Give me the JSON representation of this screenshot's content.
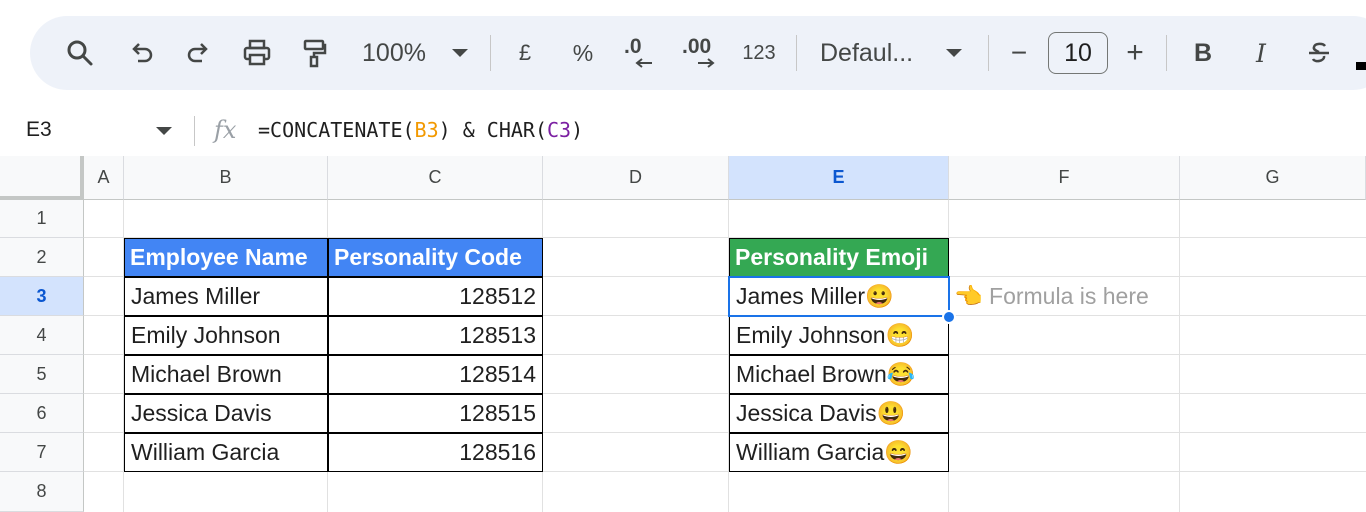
{
  "toolbar": {
    "zoom": "100%",
    "currency": "£",
    "percent": "%",
    "decrease_decimal": ".0",
    "increase_decimal": ".00",
    "more_formats": "123",
    "font_name": "Defaul...",
    "font_size": "10",
    "minus": "−",
    "plus": "+",
    "bold": "B",
    "italic": "I",
    "icons": [
      "search-icon",
      "undo-icon",
      "redo-icon",
      "print-icon",
      "paint-format-icon",
      "strikethrough-icon"
    ]
  },
  "formula_bar": {
    "cell_ref": "E3",
    "fx": "fx",
    "formula_prefix": "=CONCATENATE(",
    "formula_ref1": "B3",
    "formula_mid": ") & CHAR(",
    "formula_ref2": "C3",
    "formula_suffix": ")"
  },
  "columns": [
    "A",
    "B",
    "C",
    "D",
    "E",
    "F",
    "G"
  ],
  "rows": [
    "1",
    "2",
    "3",
    "4",
    "5",
    "6",
    "7",
    "8"
  ],
  "active_cell": "E3",
  "table1": {
    "headers": [
      "Employee Name",
      "Personality Code"
    ],
    "rows": [
      {
        "name": "James Miller",
        "code": "128512"
      },
      {
        "name": "Emily Johnson",
        "code": "128513"
      },
      {
        "name": "Michael Brown",
        "code": "128514"
      },
      {
        "name": "Jessica Davis",
        "code": "128515"
      },
      {
        "name": "William Garcia",
        "code": "128516"
      }
    ]
  },
  "table2": {
    "header": "Personality Emoji",
    "rows": [
      "James Miller😀",
      "Emily Johnson😁",
      "Michael Brown😂",
      "Jessica Davis😃",
      "William Garcia😄"
    ]
  },
  "note": "👈 Formula is here",
  "colors": {
    "header_blue": "#4285f4",
    "header_green": "#34a853",
    "selection": "#1a73e8",
    "active_header": "#d3e3fd"
  }
}
